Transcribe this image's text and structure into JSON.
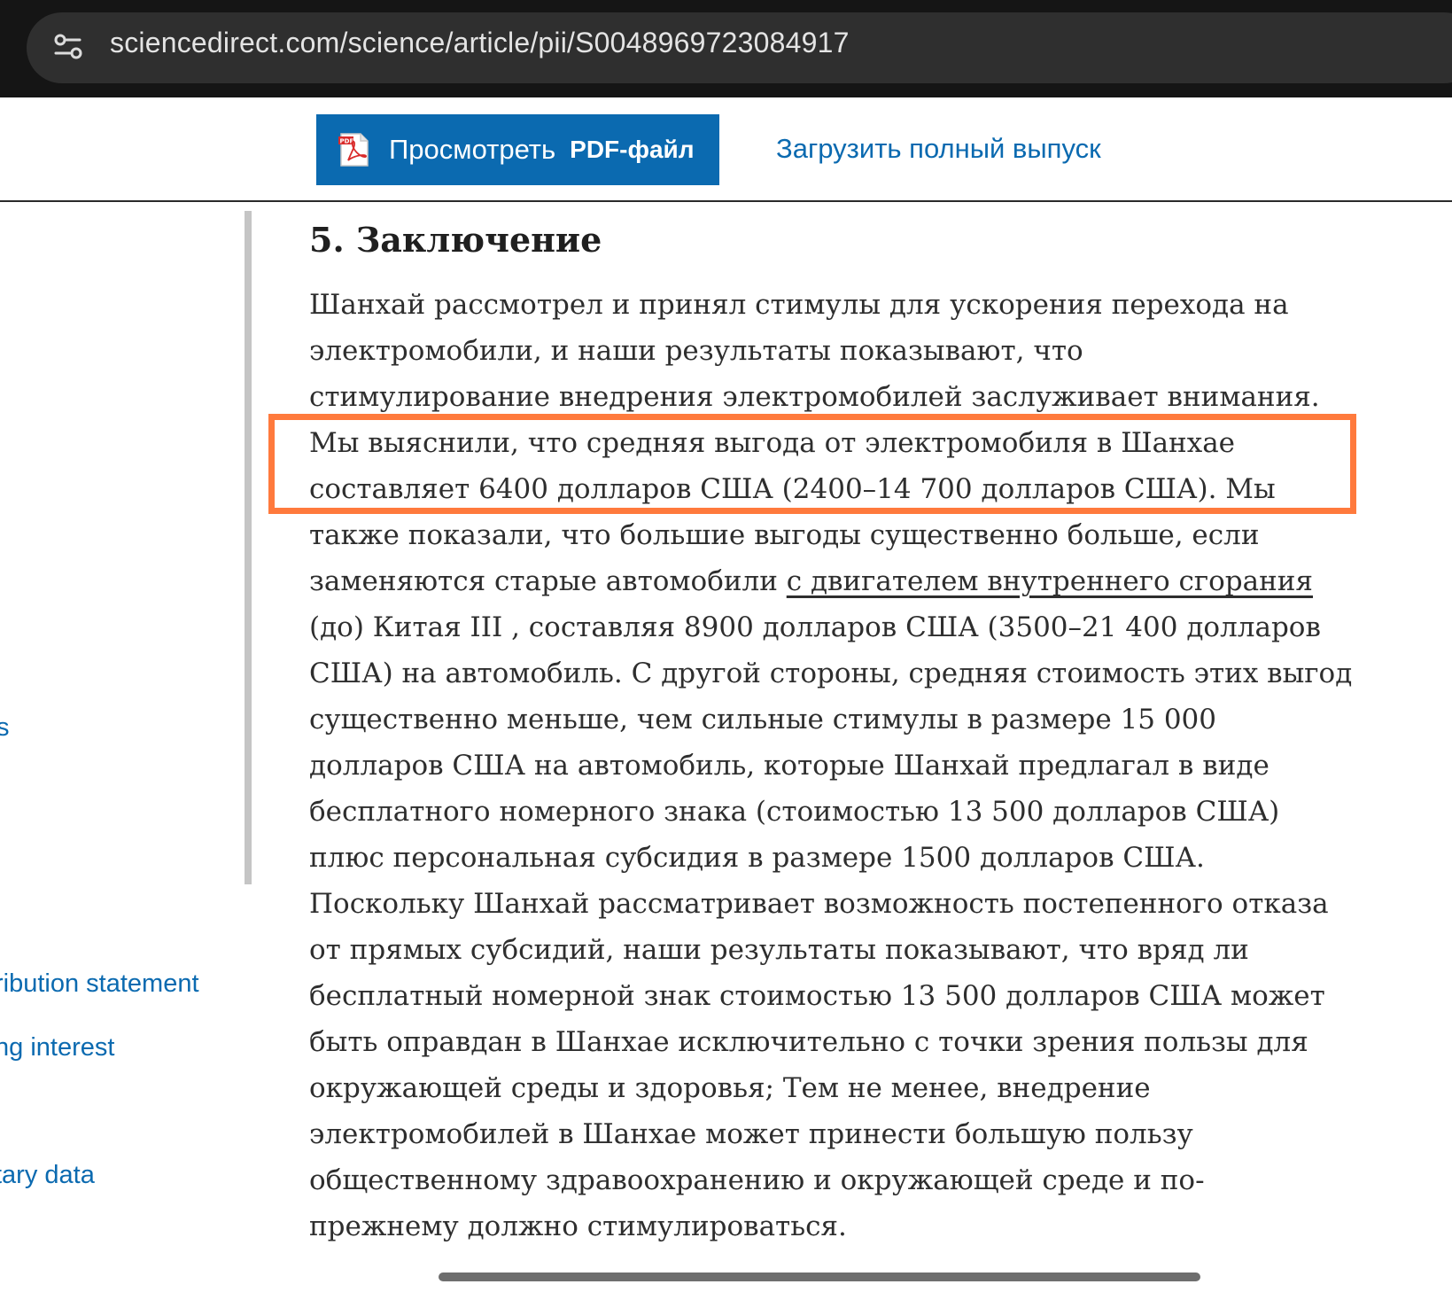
{
  "browser": {
    "url": "sciencedirect.com/science/article/pii/S0048969723084917",
    "site_settings_icon": "tune-icon"
  },
  "toolbar": {
    "pdf_button_prefix": "Просмотреть",
    "pdf_button_bold": "PDF-файл",
    "pdf_icon": "pdf-file-icon",
    "download_link": "Загрузить полный выпуск"
  },
  "sidebar": {
    "items": [
      "s",
      "ribution statement",
      "ng interest",
      "tary data"
    ]
  },
  "article": {
    "section_title": "5. Заключение",
    "lines": [
      "Шанхай рассмотрел и принял стимулы для ускорения перехода на",
      "электромобили, и наши результаты показывают, что",
      "стимулирование внедрения электромобилей заслуживает внимания.",
      "Мы выяснили, что средняя выгода от электромобиля в Шанхае",
      "составляет 6400 долларов США (2400–14 700 долларов США). Мы",
      "также показали, что большие выгоды существенно больше, если",
      "заменяются старые автомобили ",
      "(до) Китая III , составляя 8900 долларов США (3500–21 400 долларов",
      "США) на автомобиль. С другой стороны, средняя стоимость этих выгод",
      "существенно меньше, чем сильные стимулы в размере 15 000",
      "долларов США на автомобиль, которые Шанхай предлагал в виде",
      "бесплатного номерного знака (стоимостью 13 500 долларов США)",
      "плюс персональная субсидия в размере 1500 долларов США.",
      "Поскольку Шанхай рассматривает возможность постепенного отказа",
      "от прямых субсидий, наши результаты показывают, что вряд ли",
      "бесплатный номерной знак стоимостью 13 500 долларов США может",
      "быть оправдан в Шанхае исключительно с точки зрения пользы для",
      "окружающей среды и здоровья; Тем не менее, внедрение",
      "электромобилей в Шанхае может принести большую пользу",
      "общественному здравоохранению и окружающей среде и по-",
      "прежнему должно стимулироваться."
    ],
    "ice_link": "с двигателем внутреннего сгорания"
  },
  "colors": {
    "accent_blue": "#0b6ab0",
    "highlight_orange": "#ff7a3d",
    "browser_dark": "#151515"
  }
}
